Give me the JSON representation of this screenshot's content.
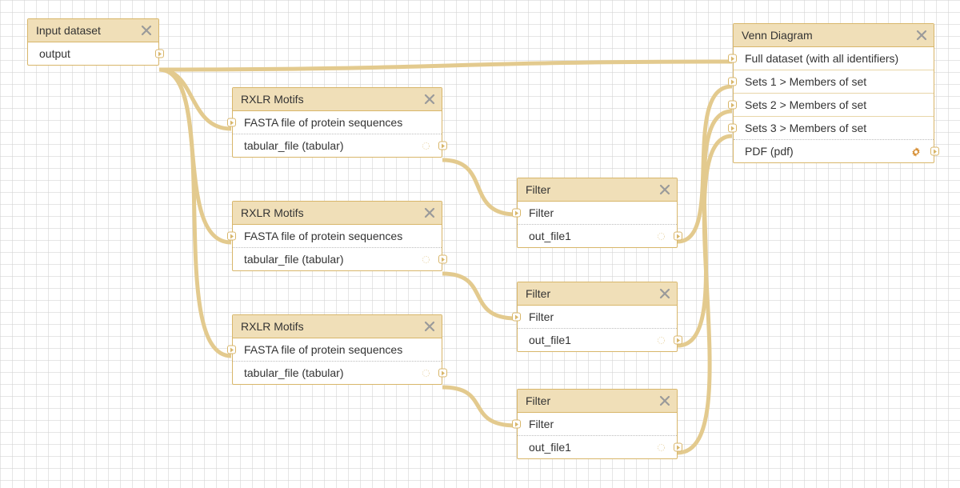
{
  "icons": {
    "close": "close-icon",
    "gear": "gear-icon",
    "port": "port-icon"
  },
  "nodes": {
    "input": {
      "title": "Input dataset",
      "outputs": [
        "output"
      ]
    },
    "rxlr1": {
      "title": "RXLR Motifs",
      "inputs": [
        "FASTA file of protein sequences"
      ],
      "outputs": [
        "tabular_file (tabular)"
      ]
    },
    "rxlr2": {
      "title": "RXLR Motifs",
      "inputs": [
        "FASTA file of protein sequences"
      ],
      "outputs": [
        "tabular_file (tabular)"
      ]
    },
    "rxlr3": {
      "title": "RXLR Motifs",
      "inputs": [
        "FASTA file of protein sequences"
      ],
      "outputs": [
        "tabular_file (tabular)"
      ]
    },
    "filter1": {
      "title": "Filter",
      "inputs": [
        "Filter"
      ],
      "outputs": [
        "out_file1"
      ]
    },
    "filter2": {
      "title": "Filter",
      "inputs": [
        "Filter"
      ],
      "outputs": [
        "out_file1"
      ]
    },
    "filter3": {
      "title": "Filter",
      "inputs": [
        "Filter"
      ],
      "outputs": [
        "out_file1"
      ]
    },
    "venn": {
      "title": "Venn Diagram",
      "inputs": [
        "Full dataset (with all identifiers)",
        "Sets 1 > Members of set",
        "Sets 2 > Members of set",
        "Sets 3 > Members of set"
      ],
      "outputs": [
        "PDF (pdf)"
      ]
    }
  },
  "edges": [
    {
      "from": "input.output",
      "to": "rxlr1.input"
    },
    {
      "from": "input.output",
      "to": "rxlr2.input"
    },
    {
      "from": "input.output",
      "to": "rxlr3.input"
    },
    {
      "from": "input.output",
      "to": "venn.full"
    },
    {
      "from": "rxlr1.tabular",
      "to": "filter1.input"
    },
    {
      "from": "rxlr2.tabular",
      "to": "filter2.input"
    },
    {
      "from": "rxlr3.tabular",
      "to": "filter3.input"
    },
    {
      "from": "filter1.out",
      "to": "venn.set1"
    },
    {
      "from": "filter2.out",
      "to": "venn.set2"
    },
    {
      "from": "filter3.out",
      "to": "venn.set3"
    }
  ]
}
